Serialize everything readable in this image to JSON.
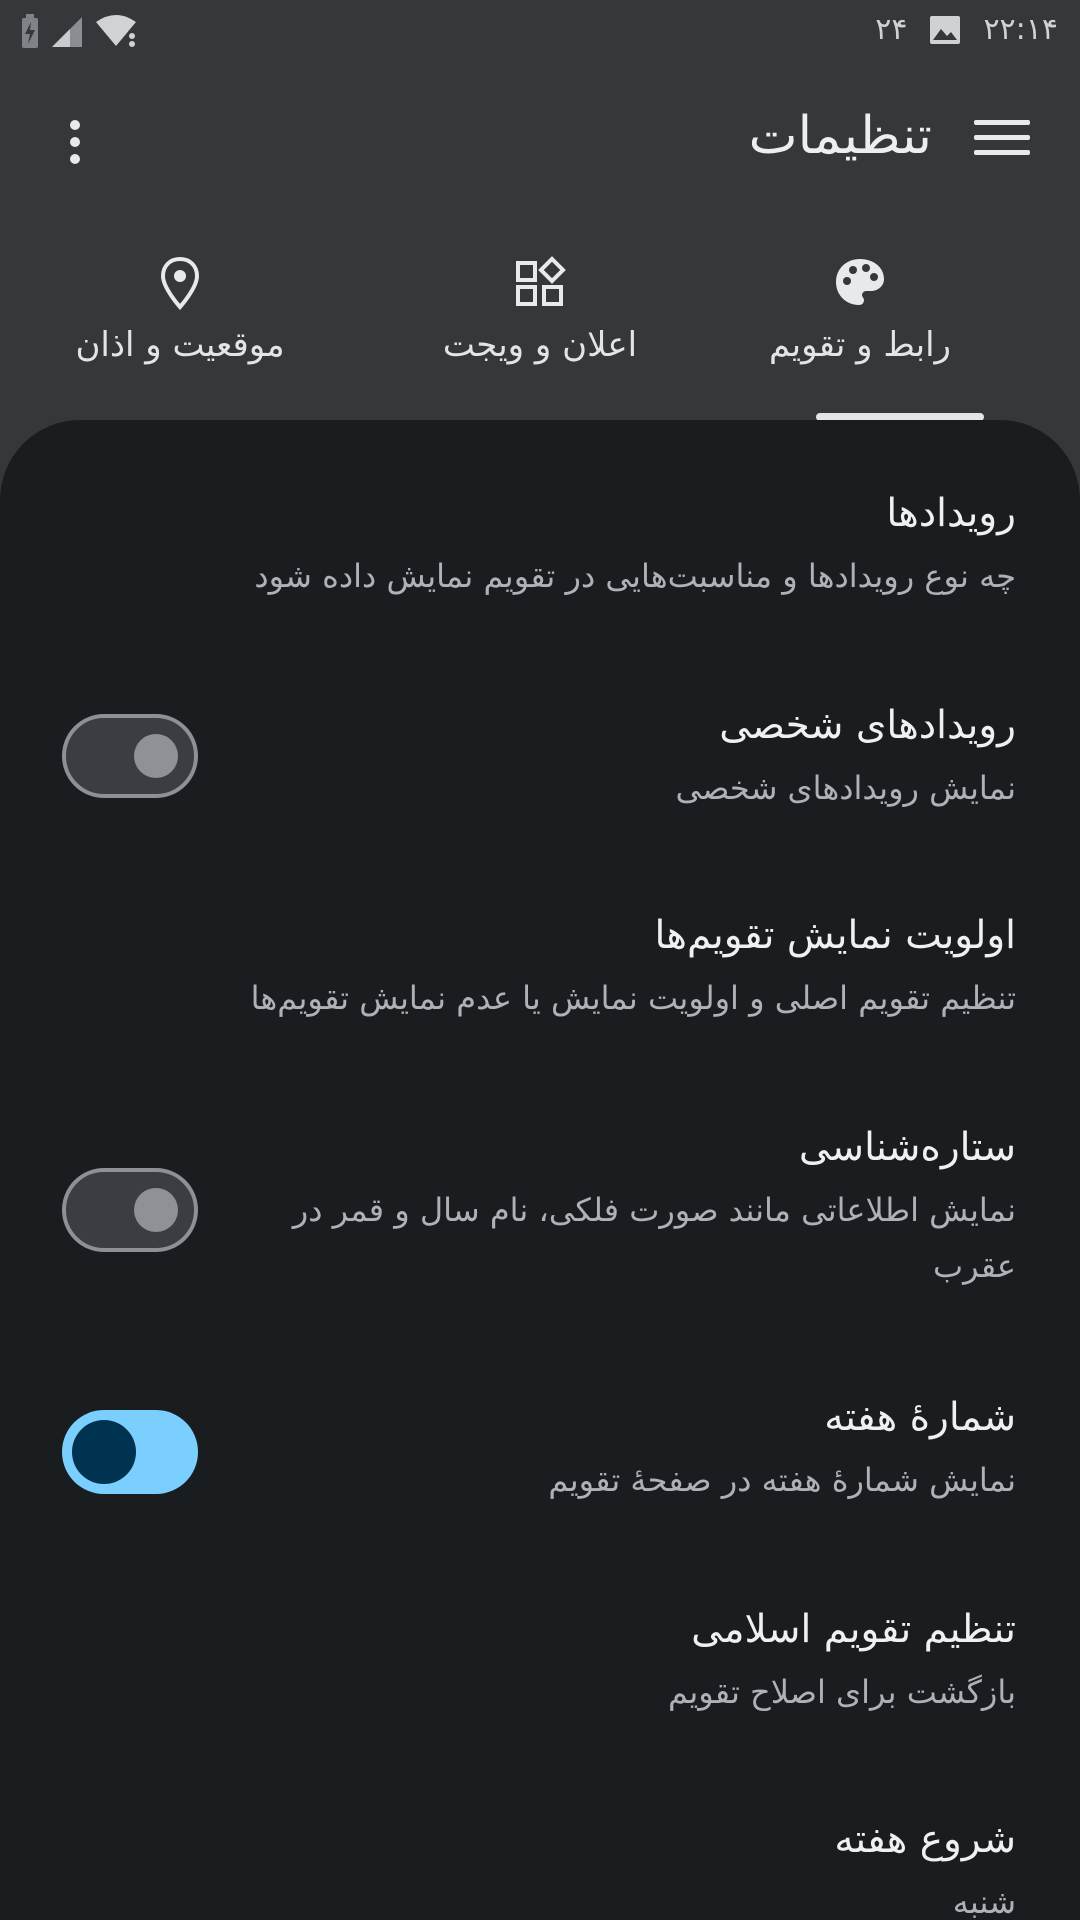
{
  "status_bar": {
    "time": "۲۲:۱۴",
    "date_day": "۲۴"
  },
  "app_bar": {
    "title": "تنظیمات"
  },
  "tabs": [
    {
      "label": "رابط و تقویم",
      "icon": "palette-icon",
      "selected": true
    },
    {
      "label": "اعلان و ویجت",
      "icon": "widgets-icon",
      "selected": false
    },
    {
      "label": "موقعیت و اذان",
      "icon": "location-pin-icon",
      "selected": false
    }
  ],
  "settings": [
    {
      "title": "رویدادها",
      "subtitle": "چه نوع رویدادها و مناسبت‌هایی در تقویم نمایش داده شود"
    },
    {
      "title": "رویدادهای شخصی",
      "subtitle": "نمایش رویدادهای شخصی",
      "toggle": false
    },
    {
      "title": "اولویت نمایش تقویم‌ها",
      "subtitle": "تنظیم تقویم اصلی و اولویت نمایش یا عدم نمایش تقویم‌ها"
    },
    {
      "title": "ستاره‌شناسی",
      "subtitle": "نمایش اطلاعاتی مانند صورت فلکی، نام سال و قمر در عقرب",
      "toggle": false
    },
    {
      "title": "شمارهٔ هفته",
      "subtitle": "نمایش شمارهٔ هفته در صفحهٔ تقویم",
      "toggle": true
    },
    {
      "title": "تنظیم تقویم اسلامی",
      "subtitle": "بازگشت برای اصلاح تقویم"
    },
    {
      "title": "شروع هفته",
      "subtitle": "شنبه"
    }
  ],
  "colors": {
    "background": "#35373a",
    "sheet": "#1a1d20",
    "accent": "#7bcfff"
  }
}
